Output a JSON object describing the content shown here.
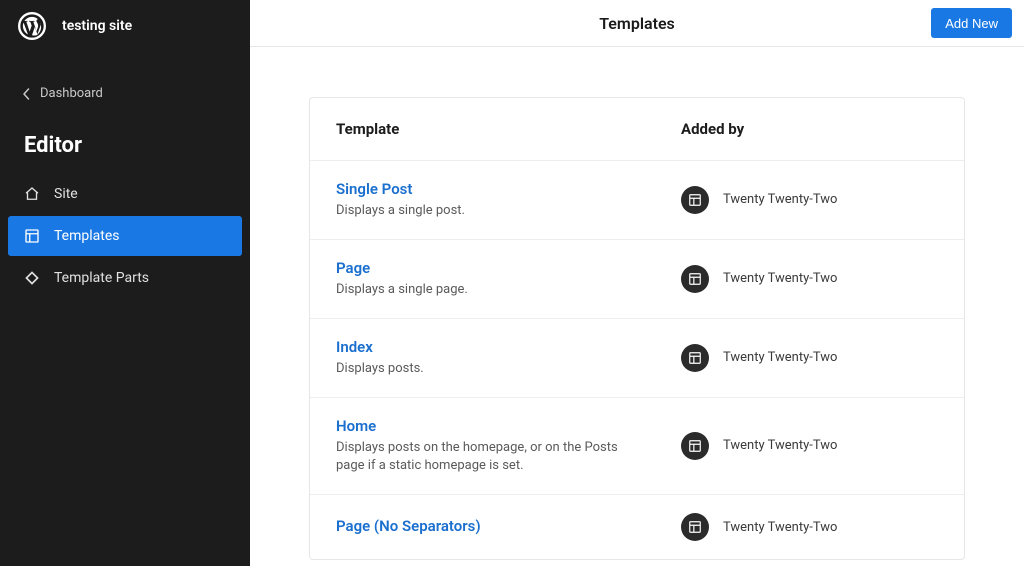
{
  "site_name": "testing site",
  "back_label": "Dashboard",
  "editor_title": "Editor",
  "nav": {
    "site": "Site",
    "templates": "Templates",
    "template_parts": "Template Parts"
  },
  "topbar": {
    "title": "Templates",
    "add_new": "Add New"
  },
  "table": {
    "head_template": "Template",
    "head_added_by": "Added by"
  },
  "templates": [
    {
      "name": "Single Post",
      "desc": "Displays a single post.",
      "added_by": "Twenty Twenty-Two"
    },
    {
      "name": "Page",
      "desc": "Displays a single page.",
      "added_by": "Twenty Twenty-Two"
    },
    {
      "name": "Index",
      "desc": "Displays posts.",
      "added_by": "Twenty Twenty-Two"
    },
    {
      "name": "Home",
      "desc": "Displays posts on the homepage, or on the Posts page if a static homepage is set.",
      "added_by": "Twenty Twenty-Two"
    },
    {
      "name": "Page (No Separators)",
      "desc": "",
      "added_by": "Twenty Twenty-Two"
    }
  ]
}
